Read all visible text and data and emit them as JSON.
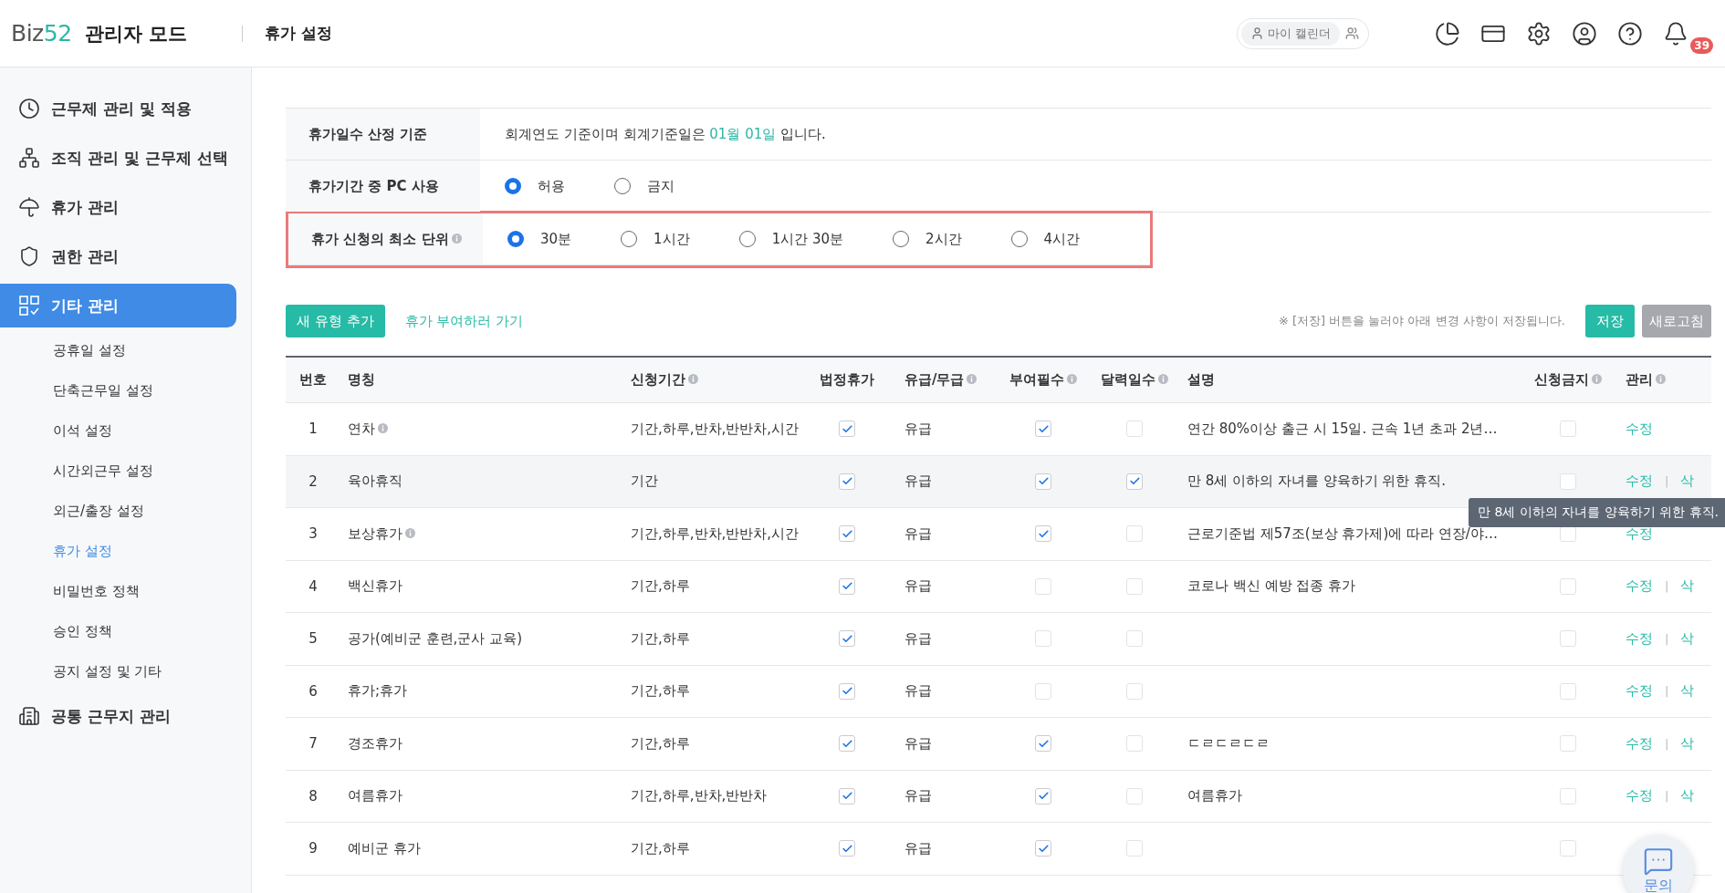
{
  "header": {
    "logo_text": "Biz",
    "logo_accent": "52",
    "mode": "관리자 모드",
    "page_title": "휴가 설정",
    "calendar_button": "마이 캘린더",
    "notification_count": "39"
  },
  "sidebar": {
    "items": [
      {
        "label": "근무제 관리 및 적용",
        "selected": false
      },
      {
        "label": "조직 관리 및 근무제 선택",
        "selected": false
      },
      {
        "label": "휴가 관리",
        "selected": false
      },
      {
        "label": "권한 관리",
        "selected": false
      },
      {
        "label": "기타 관리",
        "selected": true,
        "children": [
          {
            "label": "공휴일 설정",
            "selected": false
          },
          {
            "label": "단축근무일 설정",
            "selected": false
          },
          {
            "label": "이석 설정",
            "selected": false
          },
          {
            "label": "시간외근무 설정",
            "selected": false
          },
          {
            "label": "외근/출장 설정",
            "selected": false
          },
          {
            "label": "휴가 설정",
            "selected": true
          },
          {
            "label": "비밀번호 정책",
            "selected": false
          },
          {
            "label": "승인 정책",
            "selected": false
          },
          {
            "label": "공지 설정 및 기타",
            "selected": false
          }
        ]
      },
      {
        "label": "공통 근무지 관리",
        "selected": false
      }
    ]
  },
  "settings": [
    {
      "kind": "text",
      "label": "휴가일수 산정 기준",
      "info": false,
      "highlighted": false,
      "text_before": "회계연도 기준이며 회계기준일은 ",
      "text_accent": "01월 01일",
      "text_after": " 입니다."
    },
    {
      "kind": "radio",
      "label": "휴가기간 중 PC 사용",
      "info": false,
      "highlighted": false,
      "options": [
        {
          "label": "허용",
          "selected": true
        },
        {
          "label": "금지",
          "selected": false
        }
      ]
    },
    {
      "kind": "radio",
      "label": "휴가 신청의 최소 단위",
      "info": true,
      "highlighted": true,
      "options": [
        {
          "label": "30분",
          "selected": true
        },
        {
          "label": "1시간",
          "selected": false
        },
        {
          "label": "1시간 30분",
          "selected": false
        },
        {
          "label": "2시간",
          "selected": false
        },
        {
          "label": "4시간",
          "selected": false
        }
      ]
    }
  ],
  "toolbar": {
    "add_button": "새 유형 추가",
    "link": "휴가 부여하러 가기",
    "note": "※ [저장] 버튼을 눌러야 아래 변경 사항이 저장됩니다.",
    "save_button": "저장",
    "refresh_button": {
      "label": "새로고침",
      "disabled": true
    }
  },
  "table": {
    "columns": [
      {
        "label": "번호",
        "info": false
      },
      {
        "label": "명칭",
        "info": false
      },
      {
        "label": "신청기간",
        "info": true
      },
      {
        "label": "법정휴가",
        "info": false
      },
      {
        "label": "유급/무급",
        "info": true
      },
      {
        "label": "부여필수",
        "info": true
      },
      {
        "label": "달력일수",
        "info": true
      },
      {
        "label": "설명",
        "info": false
      },
      {
        "label": "신청금지",
        "info": true
      },
      {
        "label": "관리",
        "info": true
      }
    ],
    "rows": [
      {
        "number": "1",
        "name": "연차",
        "name_info": true,
        "period": "기간,하루,반차,반반차,시간",
        "legal": true,
        "pay": "유급",
        "required": true,
        "calendar": false,
        "description": "연간 80%이상 출근 시 15일. 근속 1년 초과 2년…",
        "prohibited": false,
        "hovered": false,
        "actions": [
          "수정"
        ]
      },
      {
        "number": "2",
        "name": "육아휴직",
        "name_info": false,
        "period": "기간",
        "legal": true,
        "pay": "유급",
        "required": true,
        "calendar": true,
        "description": "만 8세 이하의 자녀를 양육하기 위한 휴직.",
        "prohibited": false,
        "hovered": true,
        "tooltip": "만 8세 이하의 자녀를 양육하기 위한 휴직.",
        "actions": [
          "수정",
          "삭"
        ],
        "action_separator": "|"
      },
      {
        "number": "3",
        "name": "보상휴가",
        "name_info": true,
        "period": "기간,하루,반차,반반차,시간",
        "legal": true,
        "pay": "유급",
        "required": true,
        "calendar": false,
        "description": "근로기준법 제57조(보상 휴가제)에 따라 연장/야…",
        "prohibited": false,
        "hovered": false,
        "actions": [
          "수정"
        ]
      },
      {
        "number": "4",
        "name": "백신휴가",
        "name_info": false,
        "period": "기간,하루",
        "legal": true,
        "pay": "유급",
        "required": false,
        "calendar": false,
        "description": "코로나 백신 예방 접종 휴가",
        "prohibited": false,
        "hovered": false,
        "actions": [
          "수정",
          "삭"
        ],
        "action_separator": "|"
      },
      {
        "number": "5",
        "name": "공가(예비군 훈련,군사 교육)",
        "name_info": false,
        "period": "기간,하루",
        "legal": true,
        "pay": "유급",
        "required": false,
        "calendar": false,
        "prohibited": false,
        "hovered": false,
        "actions": [
          "수정",
          "삭"
        ],
        "action_separator": "|"
      },
      {
        "number": "6",
        "name": "휴가;휴가",
        "name_info": false,
        "period": "기간,하루",
        "legal": true,
        "pay": "유급",
        "required": false,
        "calendar": false,
        "prohibited": false,
        "hovered": false,
        "actions": [
          "수정",
          "삭"
        ],
        "action_separator": "|"
      },
      {
        "number": "7",
        "name": "경조휴가",
        "name_info": false,
        "period": "기간,하루",
        "legal": true,
        "pay": "유급",
        "required": true,
        "calendar": false,
        "description": "ㄷㄹㄷㄹㄷㄹ",
        "prohibited": false,
        "hovered": false,
        "actions": [
          "수정",
          "삭"
        ],
        "action_separator": "|"
      },
      {
        "number": "8",
        "name": "여름휴가",
        "name_info": false,
        "period": "기간,하루,반차,반반차",
        "legal": true,
        "pay": "유급",
        "required": true,
        "calendar": false,
        "description": "여름휴가",
        "prohibited": false,
        "hovered": false,
        "actions": [
          "수정",
          "삭"
        ],
        "action_separator": "|"
      },
      {
        "number": "9",
        "name": "예비군 휴가",
        "name_info": false,
        "period": "기간,하루",
        "legal": true,
        "pay": "유급",
        "required": true,
        "calendar": false,
        "prohibited": false,
        "hovered": false
      }
    ]
  },
  "chat_widget": {
    "label": "문의"
  }
}
